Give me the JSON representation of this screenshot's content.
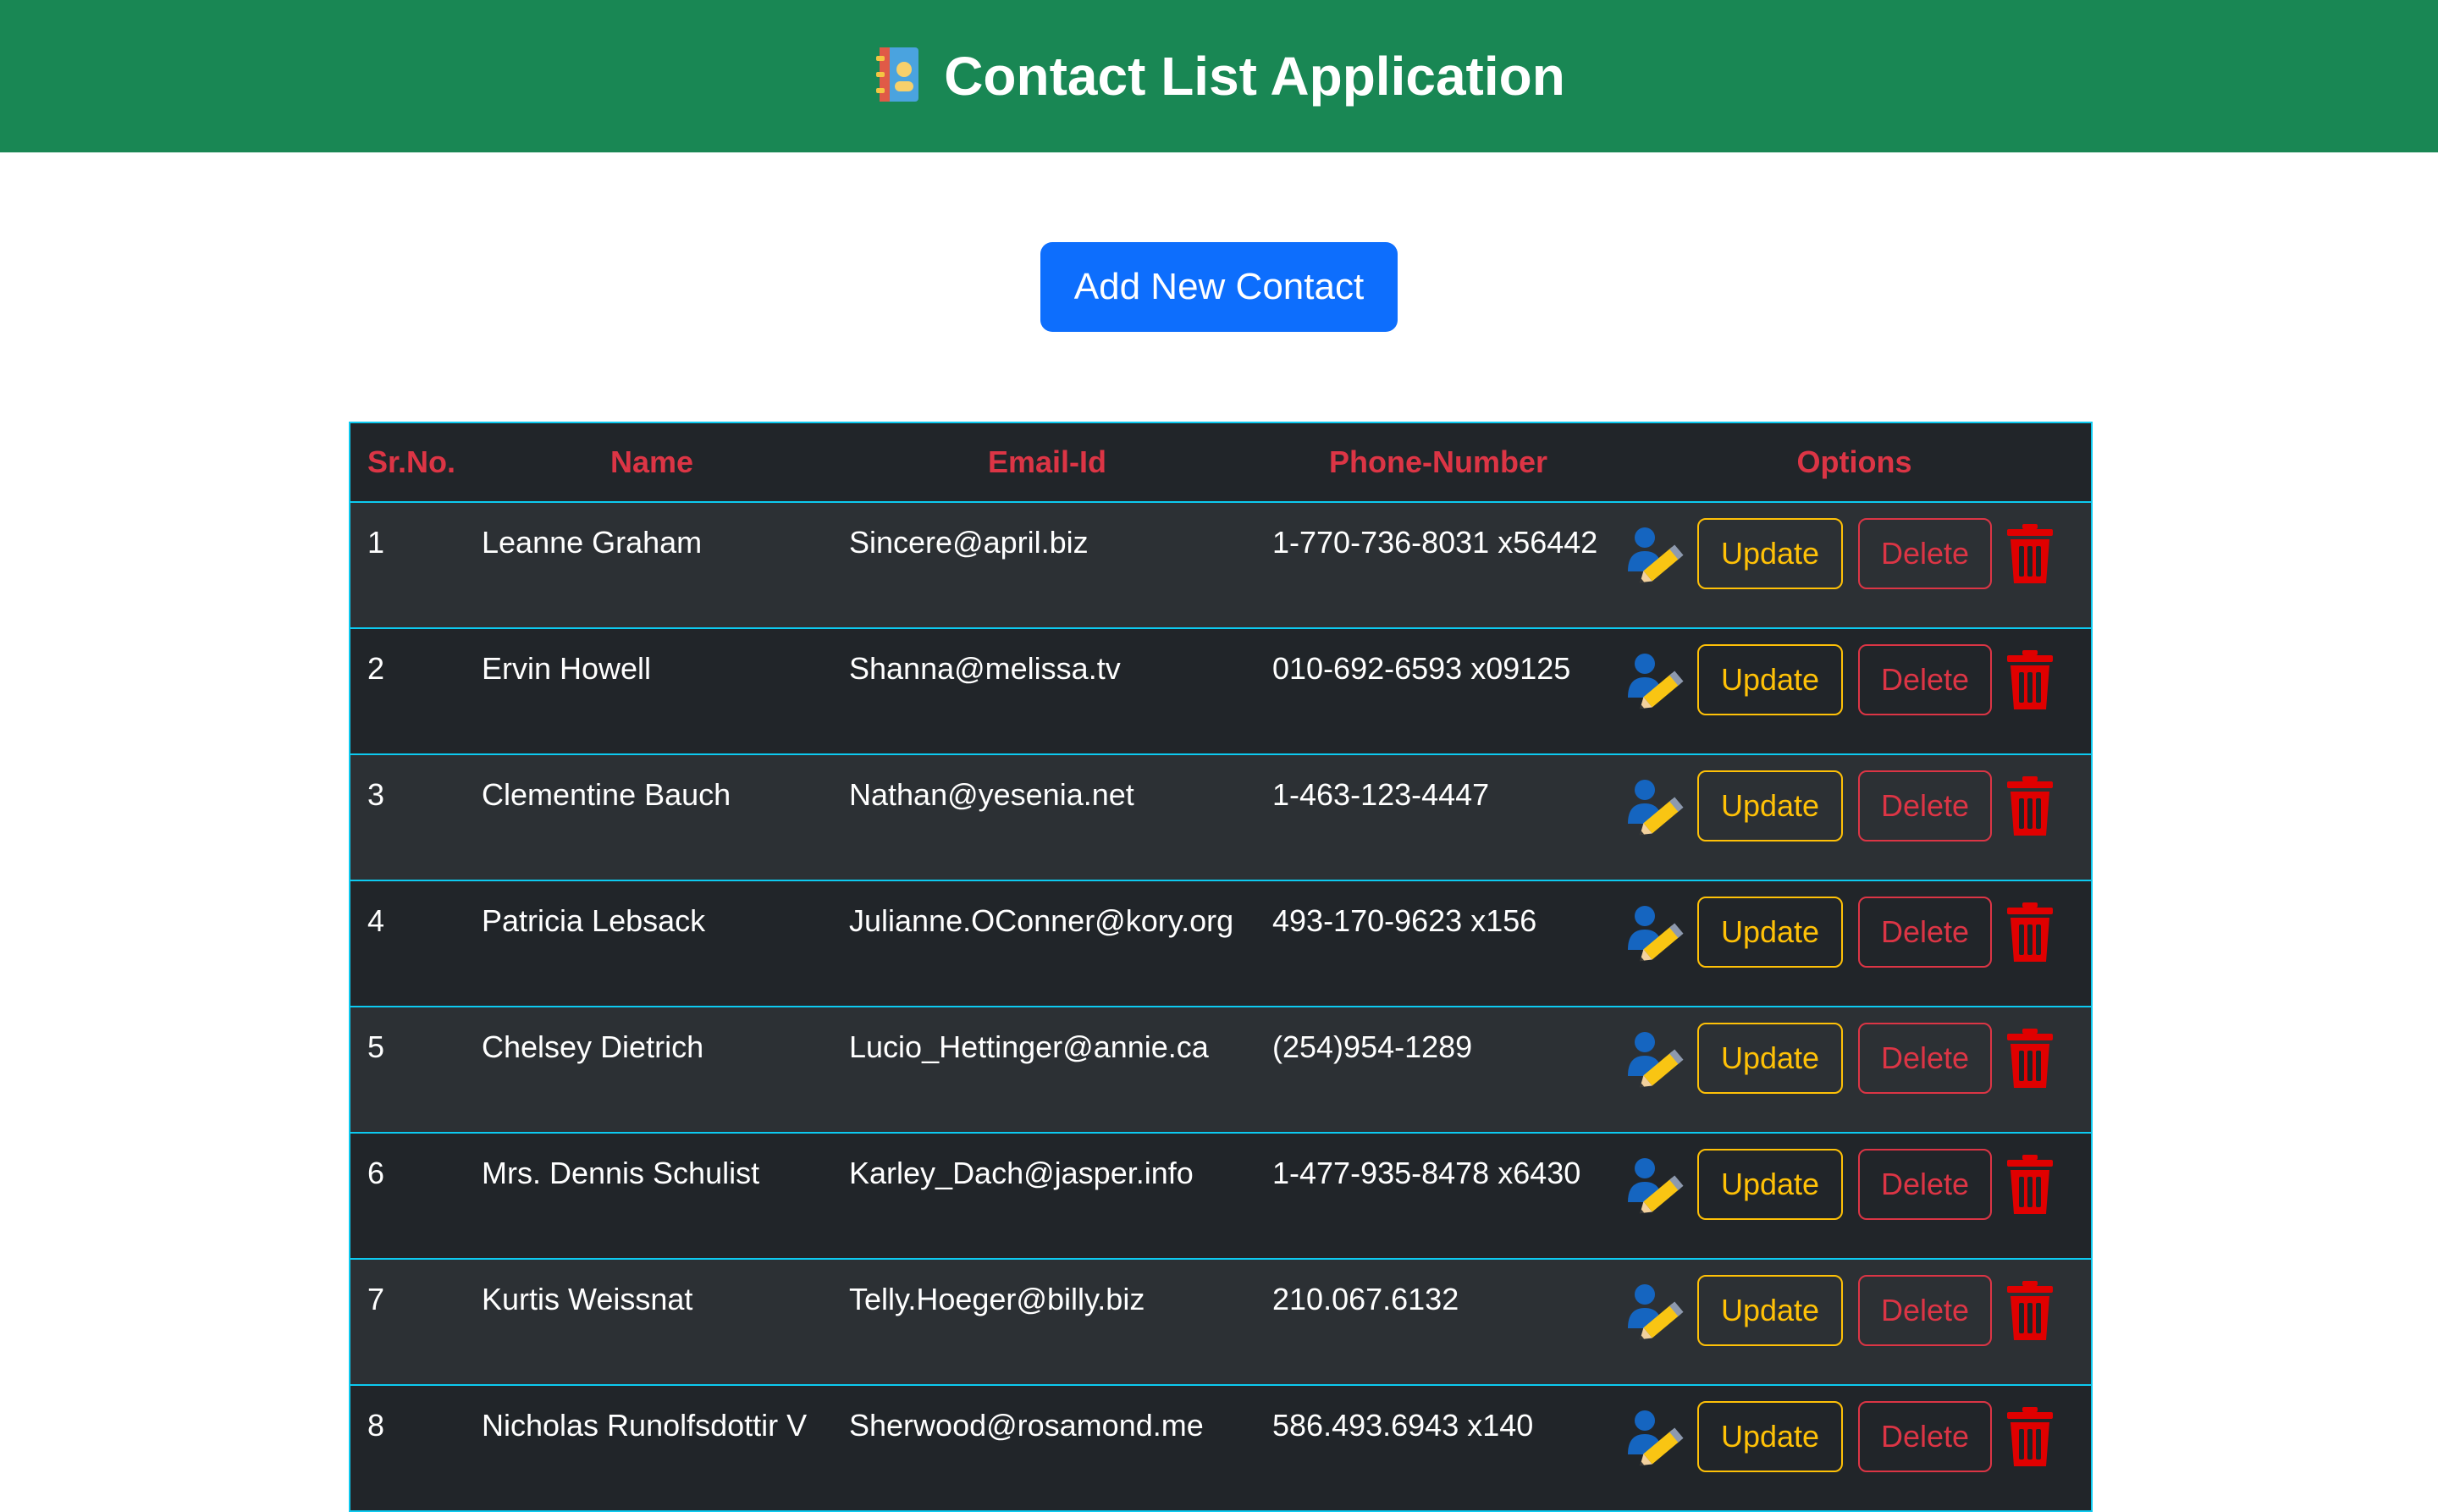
{
  "header": {
    "title": "Contact List Application",
    "icon": "address-book-icon"
  },
  "actions": {
    "add_label": "Add New Contact"
  },
  "table": {
    "columns": [
      "Sr.No.",
      "Name",
      "Email-Id",
      "Phone-Number",
      "Options"
    ],
    "update_label": "Update",
    "delete_label": "Delete",
    "rows": [
      {
        "no": "1",
        "name": "Leanne Graham",
        "email": "Sincere@april.biz",
        "phone": "1-770-736-8031 x56442"
      },
      {
        "no": "2",
        "name": "Ervin Howell",
        "email": "Shanna@melissa.tv",
        "phone": "010-692-6593 x09125"
      },
      {
        "no": "3",
        "name": "Clementine Bauch",
        "email": "Nathan@yesenia.net",
        "phone": "1-463-123-4447"
      },
      {
        "no": "4",
        "name": "Patricia Lebsack",
        "email": "Julianne.OConner@kory.org",
        "phone": "493-170-9623 x156"
      },
      {
        "no": "5",
        "name": "Chelsey Dietrich",
        "email": "Lucio_Hettinger@annie.ca",
        "phone": "(254)954-1289"
      },
      {
        "no": "6",
        "name": "Mrs. Dennis Schulist",
        "email": "Karley_Dach@jasper.info",
        "phone": "1-477-935-8478 x6430"
      },
      {
        "no": "7",
        "name": "Kurtis Weissnat",
        "email": "Telly.Hoeger@billy.biz",
        "phone": "210.067.6132"
      },
      {
        "no": "8",
        "name": "Nicholas Runolfsdottir V",
        "email": "Sherwood@rosamond.me",
        "phone": "586.493.6943 x140"
      }
    ]
  },
  "colors": {
    "header_bg": "#198754",
    "primary": "#0d6efd",
    "table_bg": "#212529",
    "table_border": "#0dcaf0",
    "heading_text": "#dc3545",
    "update": "#ffc107",
    "delete": "#dc3545"
  }
}
